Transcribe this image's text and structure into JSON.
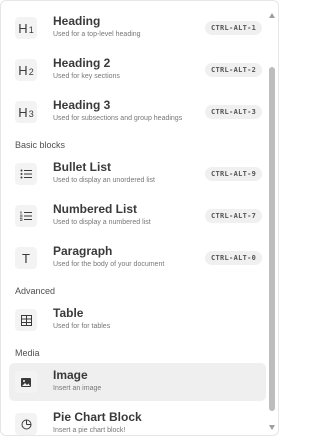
{
  "menu": {
    "items": [
      {
        "icon": "heading-1-icon",
        "icon_glyph": "H",
        "icon_sub": "1",
        "title": "Heading",
        "desc": "Used for a top-level heading",
        "shortcut": "CTRL-ALT-1"
      },
      {
        "icon": "heading-2-icon",
        "icon_glyph": "H",
        "icon_sub": "2",
        "title": "Heading 2",
        "desc": "Used for key sections",
        "shortcut": "CTRL-ALT-2"
      },
      {
        "icon": "heading-3-icon",
        "icon_glyph": "H",
        "icon_sub": "3",
        "title": "Heading 3",
        "desc": "Used for subsections and group headings",
        "shortcut": "CTRL-ALT-3"
      }
    ],
    "sections": {
      "basic_blocks": "Basic blocks",
      "advanced": "Advanced",
      "media": "Media"
    },
    "basic": [
      {
        "icon": "bullet-list-icon",
        "title": "Bullet List",
        "desc": "Used to display an unordered list",
        "shortcut": "CTRL-ALT-9"
      },
      {
        "icon": "numbered-list-icon",
        "title": "Numbered List",
        "desc": "Used to display a numbered list",
        "shortcut": "CTRL-ALT-7"
      },
      {
        "icon": "paragraph-icon",
        "icon_glyph": "T",
        "title": "Paragraph",
        "desc": "Used for the body of your document",
        "shortcut": "CTRL-ALT-0"
      }
    ],
    "advanced_items": [
      {
        "icon": "table-icon",
        "title": "Table",
        "desc": "Used for for tables"
      }
    ],
    "media_items": [
      {
        "icon": "image-icon",
        "title": "Image",
        "desc": "Insert an image",
        "selected": true
      },
      {
        "icon": "pie-chart-icon",
        "title": "Pie Chart Block",
        "desc": "Insert a pie chart block!"
      }
    ]
  },
  "colors": {
    "selected_bg": "#efefef",
    "badge_bg": "#f0f0f0",
    "scroll_thumb": "#bdbdbd"
  }
}
